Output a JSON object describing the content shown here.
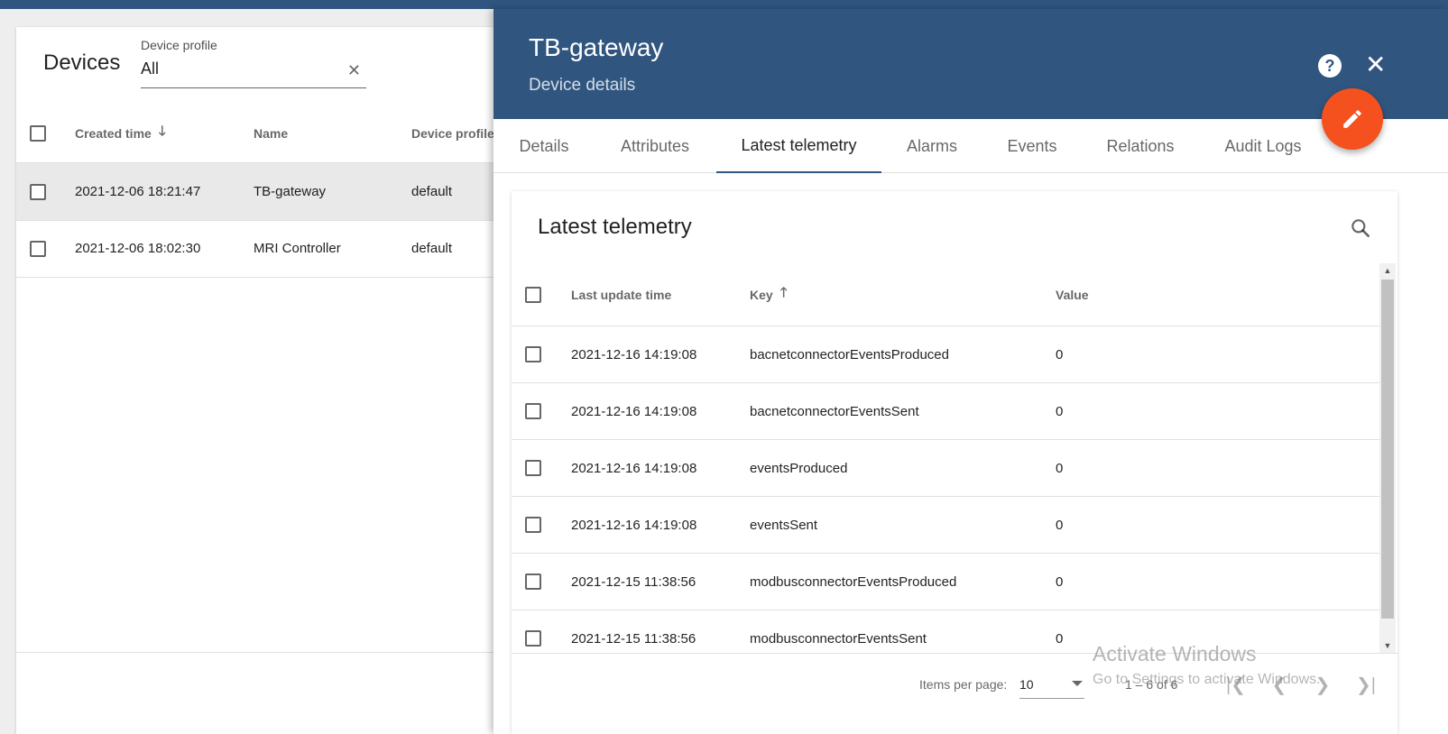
{
  "colors": {
    "header": "#305680",
    "accent": "#f4511e"
  },
  "devices": {
    "title": "Devices",
    "profile_filter": {
      "label": "Device profile",
      "value": "All"
    },
    "columns": {
      "created": "Created time",
      "name": "Name",
      "profile": "Device profile"
    },
    "rows": [
      {
        "created": "2021-12-06 18:21:47",
        "name": "TB-gateway",
        "profile": "default"
      },
      {
        "created": "2021-12-06 18:02:30",
        "name": "MRI Controller",
        "profile": "default"
      }
    ]
  },
  "details": {
    "title": "TB-gateway",
    "subtitle": "Device details",
    "help_icon": "help-circle",
    "close_icon": "close",
    "edit_icon": "pencil",
    "tabs": [
      "Details",
      "Attributes",
      "Latest telemetry",
      "Alarms",
      "Events",
      "Relations",
      "Audit Logs"
    ],
    "active_tab": "Latest telemetry"
  },
  "telemetry": {
    "title": "Latest telemetry",
    "columns": {
      "time": "Last update time",
      "key": "Key",
      "value": "Value"
    },
    "rows": [
      {
        "time": "2021-12-16 14:19:08",
        "key": "bacnetconnectorEventsProduced",
        "value": "0"
      },
      {
        "time": "2021-12-16 14:19:08",
        "key": "bacnetconnectorEventsSent",
        "value": "0"
      },
      {
        "time": "2021-12-16 14:19:08",
        "key": "eventsProduced",
        "value": "0"
      },
      {
        "time": "2021-12-16 14:19:08",
        "key": "eventsSent",
        "value": "0"
      },
      {
        "time": "2021-12-15 11:38:56",
        "key": "modbusconnectorEventsProduced",
        "value": "0"
      },
      {
        "time": "2021-12-15 11:38:56",
        "key": "modbusconnectorEventsSent",
        "value": "0"
      }
    ],
    "paginator": {
      "items_label": "Items per page:",
      "page_size": "10",
      "range": "1 – 6 of 6"
    }
  },
  "watermark": {
    "line1": "Activate Windows",
    "line2": "Go to Settings to activate Windows."
  }
}
